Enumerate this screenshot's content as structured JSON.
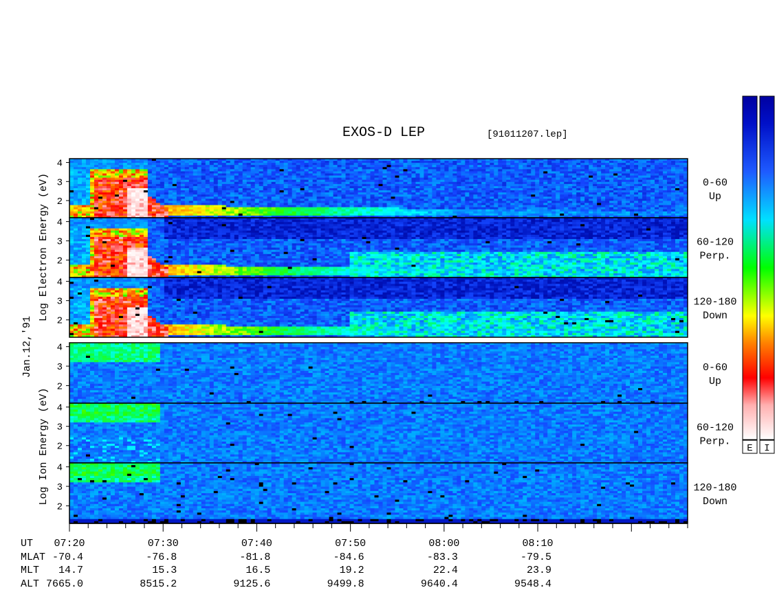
{
  "title": "EXOS-D LEP",
  "file_tag": "[91011207.lep]",
  "date_label": "Jan.12,'91",
  "electron_ylabel": "Log Electron Energy (eV)",
  "ion_ylabel": "Log Ion Energy (eV)",
  "colorbar_labels": [
    "E",
    "I"
  ],
  "colors": {
    "scale": [
      "#ffffff",
      "#ff0000",
      "#ff7f00",
      "#ffff00",
      "#00ff00",
      "#00ffff",
      "#1e5bff",
      "#0000a0"
    ],
    "background_blue": "#0018b0"
  },
  "panels": [
    {
      "group": "electron",
      "angle": "0-60",
      "direction": "Up"
    },
    {
      "group": "electron",
      "angle": "60-120",
      "direction": "Perp."
    },
    {
      "group": "electron",
      "angle": "120-180",
      "direction": "Down"
    },
    {
      "group": "ion",
      "angle": "0-60",
      "direction": "Up"
    },
    {
      "group": "ion",
      "angle": "60-120",
      "direction": "Perp."
    },
    {
      "group": "ion",
      "angle": "120-180",
      "direction": "Down"
    }
  ],
  "row_labels": [
    "UT",
    "MLAT",
    "MLT",
    "ALT"
  ],
  "chart_data": {
    "type": "heatmap",
    "title": "EXOS-D LEP",
    "x_ticks": [
      "07:20",
      "07:30",
      "07:40",
      "07:50",
      "08:00",
      "08:10"
    ],
    "x_minutes_range": [
      0,
      66
    ],
    "y_ticks": [
      "2",
      "3",
      "4"
    ],
    "y_range_log_eV": [
      1.1,
      4.2
    ],
    "ephemeris": {
      "UT": [
        "07:20",
        "07:30",
        "07:40",
        "07:50",
        "08:00",
        "08:10"
      ],
      "MLAT": [
        "-70.4",
        "-76.8",
        "-81.8",
        "-84.6",
        "-83.3",
        "-79.5"
      ],
      "MLT": [
        "14.7",
        "15.3",
        "16.5",
        "19.2",
        "22.4",
        "23.9"
      ],
      "ALT": [
        "7665.0",
        "8515.2",
        "9125.6",
        "9499.8",
        "9640.4",
        "9548.4"
      ]
    }
  }
}
